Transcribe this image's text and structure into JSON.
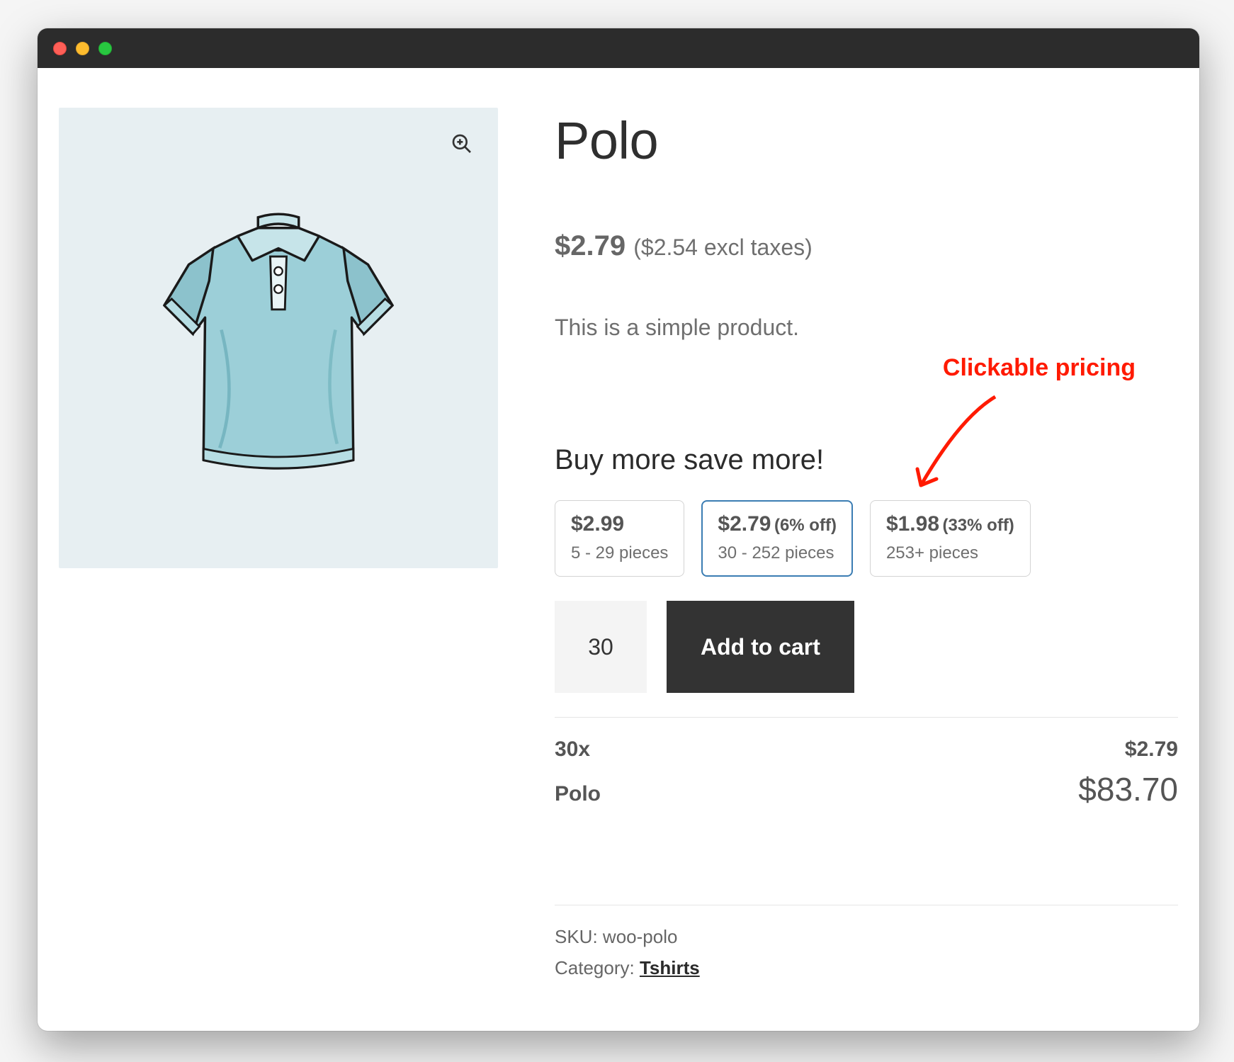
{
  "product": {
    "title": "Polo",
    "price_main": "$2.79",
    "price_sub": "($2.54 excl taxes)",
    "description": "This is a simple product."
  },
  "tiers": {
    "heading": "Buy more save more!",
    "items": [
      {
        "price": "$2.99",
        "discount": "",
        "range": "5 - 29 pieces",
        "selected": false
      },
      {
        "price": "$2.79",
        "discount": "(6% off)",
        "range": "30 - 252 pieces",
        "selected": true
      },
      {
        "price": "$1.98",
        "discount": "(33% off)",
        "range": "253+ pieces",
        "selected": false
      }
    ]
  },
  "cart": {
    "quantity": "30",
    "add_label": "Add to cart"
  },
  "summary": {
    "qty_label": "30x",
    "unit_price": "$2.79",
    "name": "Polo",
    "total": "$83.70"
  },
  "meta": {
    "sku_label": "SKU: ",
    "sku_value": "woo-polo",
    "category_label": "Category: ",
    "category_value": "Tshirts"
  },
  "annotation": {
    "text": "Clickable pricing"
  },
  "icons": {
    "zoom": "zoom-in-icon"
  }
}
